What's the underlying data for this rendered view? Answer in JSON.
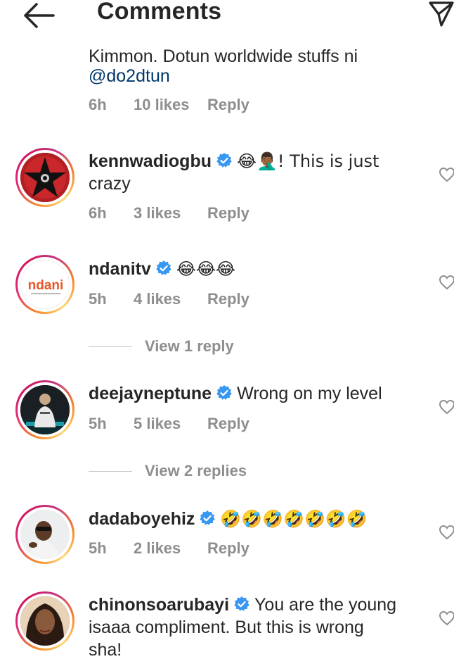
{
  "header": {
    "title": "Comments",
    "back_icon": "arrow-left-icon",
    "send_icon": "paper-plane-icon"
  },
  "partial_comment": {
    "text": "Kimmon. Dotun worldwide stuffs ni",
    "mention": "@do2dtun",
    "time": "6h",
    "likes": "10 likes",
    "reply": "Reply"
  },
  "comments": [
    {
      "username": "kennwadiogbu",
      "text_line1": "😂🤦🏾‍♂️! This is just",
      "text_line2": "crazy",
      "time": "6h",
      "likes": "3 likes",
      "reply": "Reply"
    },
    {
      "username": "ndanitv",
      "text_line1": "😂😂😂",
      "time": "5h",
      "likes": "4 likes",
      "reply": "Reply",
      "view_replies": "View 1 reply"
    },
    {
      "username": "deejayneptune",
      "text_line1": "Wrong on my level",
      "time": "5h",
      "likes": "5 likes",
      "reply": "Reply",
      "view_replies": "View 2 replies"
    },
    {
      "username": "dadaboyehiz",
      "text_line1": "🤣🤣🤣🤣🤣🤣🤣",
      "time": "5h",
      "likes": "2 likes",
      "reply": "Reply"
    },
    {
      "username": "chinonsoarubayi",
      "text_line1": "You are the young",
      "text_line2": "isaaa compliment. But this is wrong",
      "text_line3": "sha!"
    }
  ],
  "avatars": {
    "ndanitv_logo_text": "ndani"
  },
  "colors": {
    "link": "#00376b",
    "muted": "#8e8e8e",
    "verified": "#3897f0",
    "text": "#262626"
  }
}
